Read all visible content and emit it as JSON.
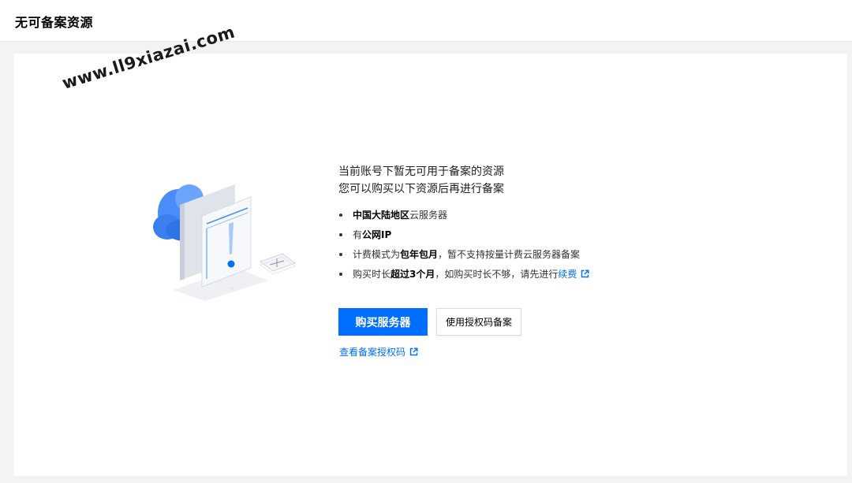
{
  "header": {
    "title": "无可备案资源"
  },
  "watermark": "www.ll9xiazai.com",
  "main": {
    "headline_line1": "当前账号下暂无可用于备案的资源",
    "headline_line2": "您可以购买以下资源后再进行备案",
    "requirements": [
      {
        "bold": "中国大陆地区",
        "rest": "云服务器"
      },
      {
        "prefix": "有",
        "bold": "公网IP"
      },
      {
        "prefix": "计费模式为",
        "bold": "包年包月",
        "rest": "，暂不支持按量计费云服务器备案"
      },
      {
        "prefix": "购买时长",
        "bold": "超过3个月",
        "rest": "，如购买时长不够，请先进行",
        "link": "续费",
        "link_icon": "external-link-icon"
      }
    ],
    "buy_button": "购买服务器",
    "auth_button": "使用授权码备案",
    "view_link": "查看备案授权码",
    "view_link_icon": "external-link-icon"
  },
  "colors": {
    "accent": "#006eff",
    "illustration_blue": "#4a8df8"
  }
}
